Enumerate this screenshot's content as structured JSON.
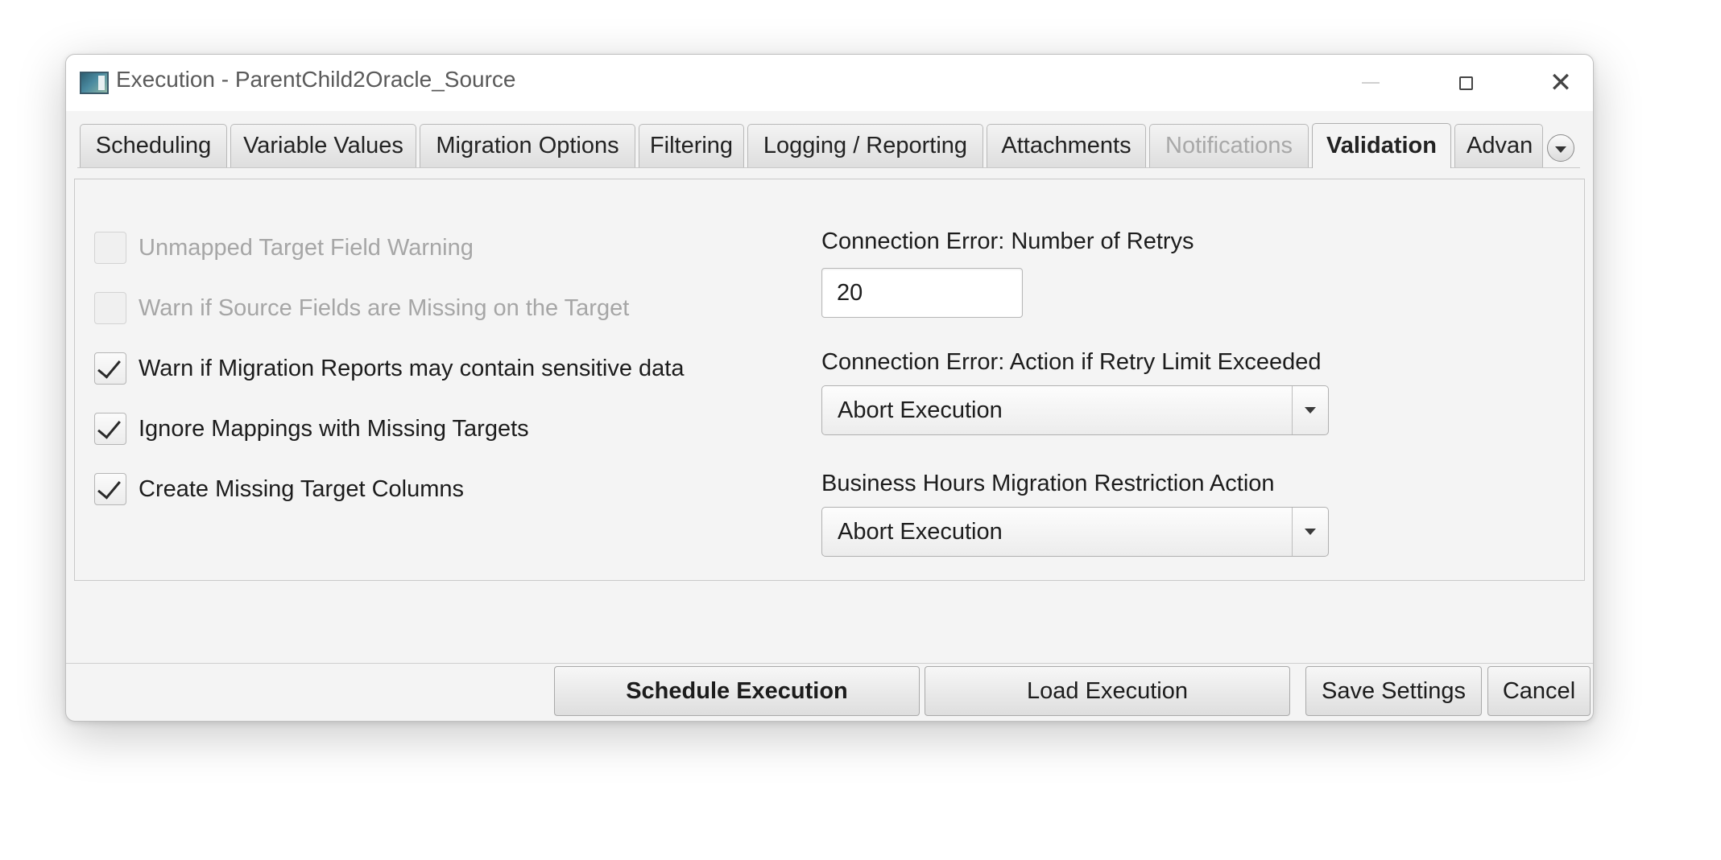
{
  "window": {
    "title": "Execution - ParentChild2Oracle_Source"
  },
  "tabs": [
    {
      "label": "Scheduling",
      "state": "normal"
    },
    {
      "label": "Variable Values",
      "state": "normal"
    },
    {
      "label": "Migration Options",
      "state": "normal"
    },
    {
      "label": "Filtering",
      "state": "normal"
    },
    {
      "label": "Logging / Reporting",
      "state": "normal"
    },
    {
      "label": "Attachments",
      "state": "normal"
    },
    {
      "label": "Notifications",
      "state": "disabled"
    },
    {
      "label": "Validation",
      "state": "active"
    },
    {
      "label": "Advan",
      "state": "clipped"
    }
  ],
  "validation": {
    "checkboxes": [
      {
        "label": "Unmapped Target Field Warning",
        "checked": false,
        "enabled": false
      },
      {
        "label": "Warn if Source Fields are Missing on the Target",
        "checked": false,
        "enabled": false
      },
      {
        "label": "Warn if Migration Reports may contain sensitive data",
        "checked": true,
        "enabled": true
      },
      {
        "label": "Ignore Mappings with Missing Targets",
        "checked": true,
        "enabled": true
      },
      {
        "label": "Create Missing Target Columns",
        "checked": true,
        "enabled": true
      }
    ],
    "retry_count": {
      "label": "Connection Error: Number of Retrys",
      "value": "20"
    },
    "retry_action": {
      "label": "Connection Error: Action if Retry Limit Exceeded",
      "value": "Abort Execution"
    },
    "business_hours_action": {
      "label": "Business Hours Migration Restriction Action",
      "value": "Abort Execution"
    }
  },
  "footer": {
    "schedule_label": "Schedule Execution",
    "load_label": "Load Execution",
    "save_label": "Save Settings",
    "cancel_label": "Cancel"
  }
}
